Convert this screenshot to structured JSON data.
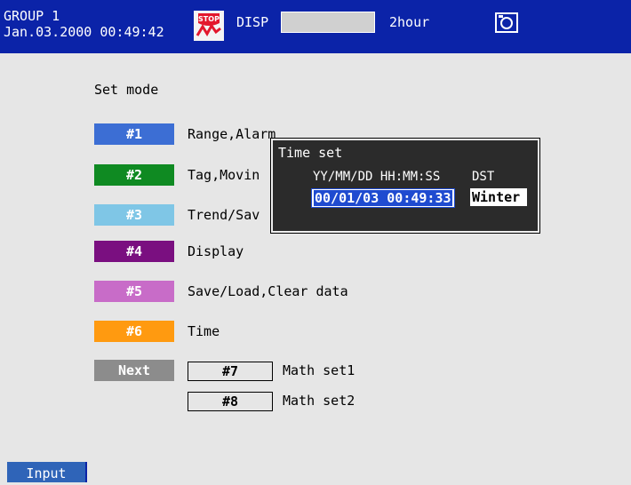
{
  "header": {
    "group": "GROUP 1",
    "datetime": "Jan.03.2000 00:49:42",
    "stop_icon": "stop-icon",
    "disp_label": "DISP",
    "trend_label": "2hour",
    "camera_icon": "camera-icon"
  },
  "main": {
    "title": "Set mode",
    "menu": [
      {
        "key": "#1",
        "label": "Range,Alarm",
        "color": "#3c6ed4"
      },
      {
        "key": "#2",
        "label": "Tag,Movin",
        "color": "#0f8a22"
      },
      {
        "key": "#3",
        "label": "Trend/Sav",
        "color": "#7fc6e6"
      },
      {
        "key": "#4",
        "label": "Display",
        "color": "#7a0f80"
      },
      {
        "key": "#5",
        "label": "Save/Load,Clear data",
        "color": "#c86cc8"
      },
      {
        "key": "#6",
        "label": "Time",
        "color": "#ff9a10"
      },
      {
        "key": "Next",
        "label": "",
        "color": "#8c8c8c"
      }
    ],
    "sub": [
      {
        "key": "#7",
        "label": "Math set1"
      },
      {
        "key": "#8",
        "label": "Math set2"
      }
    ]
  },
  "dialog": {
    "title": "Time set",
    "format_label": "YY/MM/DD HH:MM:SS",
    "dst_label": "DST",
    "value": "00/01/03 00:49:33",
    "season": "Winter"
  },
  "footer": {
    "input_label": "Input"
  },
  "colors": {
    "header_bg": "#0b23a8",
    "page_bg": "#e6e6e6",
    "highlight": "#1f4bd0"
  }
}
